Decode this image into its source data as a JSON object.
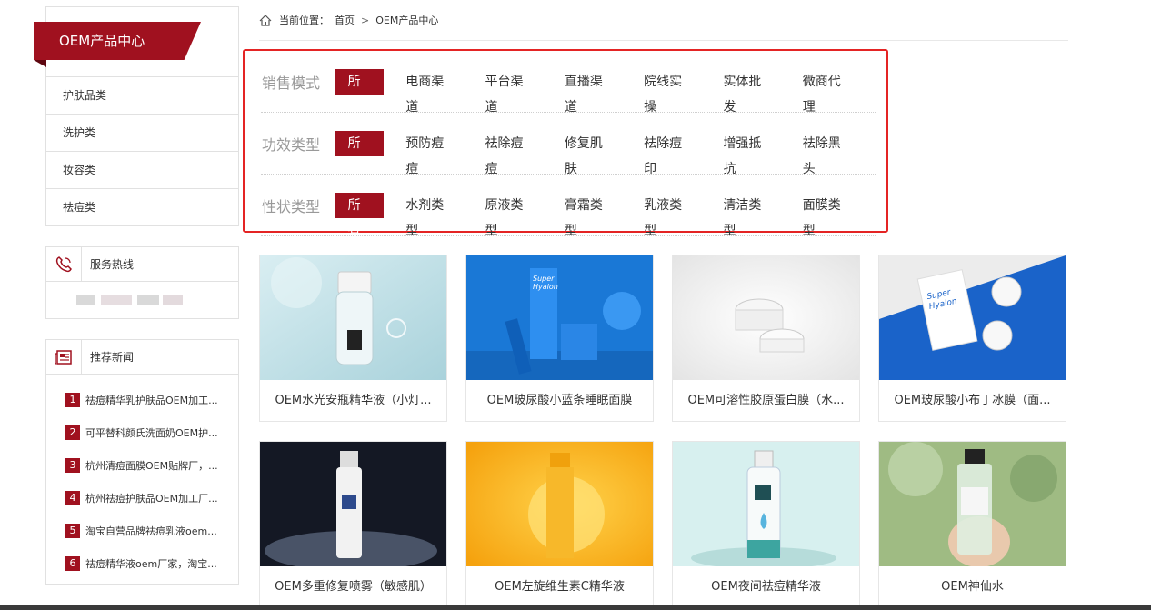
{
  "sidebar": {
    "category_title": "OEM产品中心",
    "categories": [
      "护肤品类",
      "洗护类",
      "妆容类",
      "祛痘类"
    ],
    "hotline_title": "服务热线",
    "news_title": "推荐新闻",
    "news": [
      {
        "num": "1",
        "text": "祛痘精华乳护肤品OEM加工..."
      },
      {
        "num": "2",
        "text": "可平替科颜氏洗面奶OEM护..."
      },
      {
        "num": "3",
        "text": "杭州清痘面膜OEM贴牌厂，..."
      },
      {
        "num": "4",
        "text": "杭州祛痘护肤品OEM加工厂..."
      },
      {
        "num": "5",
        "text": "淘宝自营品牌祛痘乳液oem..."
      },
      {
        "num": "6",
        "text": "祛痘精华液oem厂家，淘宝..."
      }
    ]
  },
  "breadcrumb": {
    "label": "当前位置：",
    "home": "首页",
    "sep": ">",
    "current": "OEM产品中心"
  },
  "filters": [
    {
      "label": "销售模式",
      "options": [
        "所有",
        "电商渠道",
        "平台渠道",
        "直播渠道",
        "院线实操",
        "实体批发",
        "微商代理"
      ]
    },
    {
      "label": "功效类型",
      "options": [
        "所有",
        "预防痘痘",
        "祛除痘痘",
        "修复肌肤",
        "祛除痘印",
        "增强抵抗",
        "祛除黑头"
      ]
    },
    {
      "label": "性状类型",
      "options": [
        "所有",
        "水剂类型",
        "原液类型",
        "膏霜类型",
        "乳液类型",
        "清洁类型",
        "面膜类型"
      ]
    }
  ],
  "products": [
    {
      "title": "OEM水光安瓶精华液（小灯..."
    },
    {
      "title": "OEM玻尿酸小蓝条睡眠面膜",
      "brand1": "Super",
      "brand2": "Hyalon"
    },
    {
      "title": "OEM可溶性胶原蛋白膜（水..."
    },
    {
      "title": "OEM玻尿酸小布丁冰膜（面...",
      "brand1": "Super",
      "brand2": "Hyalon"
    },
    {
      "title": "OEM多重修复喷雾（敏感肌）"
    },
    {
      "title": "OEM左旋维生素C精华液"
    },
    {
      "title": "OEM夜间祛痘精华液"
    },
    {
      "title": "OEM神仙水"
    }
  ],
  "colors": {
    "brand_red": "#a0111f",
    "highlight_border": "#e42424"
  }
}
